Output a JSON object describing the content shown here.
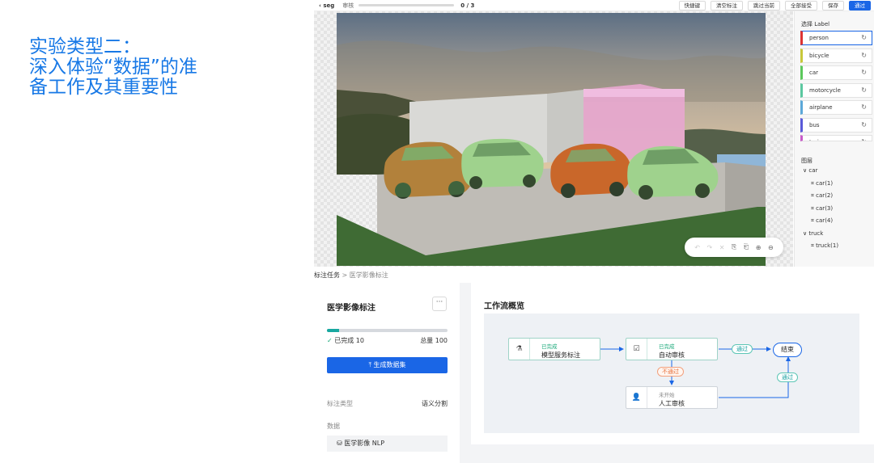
{
  "slide": {
    "title_lines": [
      "实验类型二：",
      "深入体验“数据”的准",
      "备工作及其重要性"
    ]
  },
  "toolbar": {
    "back_label": "‹ seg",
    "status_label": "审核",
    "progress_text": "0 / 3",
    "progress": 0,
    "buttons": [
      "快捷键",
      "清空标注",
      "跳过当前",
      "全部接受",
      "保存",
      "通过"
    ]
  },
  "canvas": {
    "tools": [
      "↶",
      "↷",
      "✕",
      "⎘",
      "⎗",
      "⊕",
      "⊖"
    ]
  },
  "label_panel": {
    "title": "选择 Label",
    "labels": [
      {
        "name": "person",
        "color": "#d33"
      },
      {
        "name": "bicycle",
        "color": "#c8c83a"
      },
      {
        "name": "car",
        "color": "#5cc85c"
      },
      {
        "name": "motorcycle",
        "color": "#5cc8a0"
      },
      {
        "name": "airplane",
        "color": "#5ca8d8"
      },
      {
        "name": "bus",
        "color": "#5a5ad8"
      },
      {
        "name": "train",
        "color": "#c85cc8"
      }
    ],
    "layers_title": "图层",
    "layer_groups": [
      {
        "name": "car",
        "items": [
          "car(1)",
          "car(2)",
          "car(3)",
          "car(4)"
        ]
      },
      {
        "name": "truck",
        "items": [
          "truck(1)"
        ]
      }
    ]
  },
  "breadcrumb": {
    "root": "标注任务",
    "separator": ">",
    "current": "医学影像标注"
  },
  "task_card": {
    "title": "医学影像标注",
    "more": "···",
    "completed_label": "已完成 10",
    "total_label": "总量 100",
    "progress": 0.1,
    "generate_button": "⤒ 生成数据集",
    "type_label": "标注类型",
    "type_value": "语义分割",
    "data_label": "数据",
    "data_value": "医学影像 NLP"
  },
  "workflow": {
    "title": "工作流概览",
    "nodes": [
      {
        "status": "已完成",
        "name": "模型服务标注",
        "icon": "flask-icon"
      },
      {
        "status": "已完成",
        "name": "自动审核",
        "icon": "checklist-icon"
      },
      {
        "status": "未开始",
        "name": "人工审核",
        "icon": "person-icon"
      }
    ],
    "pass_label": "通过",
    "fail_label": "不通过",
    "end_label": "结束"
  },
  "colors": {
    "accent": "#1a66e6",
    "title_blue": "#1778e6",
    "success": "#18a878",
    "fail": "#e8703a"
  }
}
